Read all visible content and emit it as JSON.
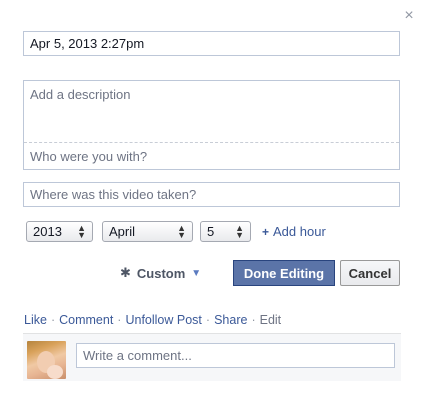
{
  "dialog": {
    "close_glyph": "×"
  },
  "form": {
    "date_value": "Apr 5, 2013 2:27pm",
    "description_placeholder": "Add a description",
    "with_placeholder": "Who were you with?",
    "location_placeholder": "Where was this video taken?"
  },
  "date_selects": {
    "year": "2013",
    "month": "April",
    "day": "5",
    "add_hour_label": "Add hour"
  },
  "controls": {
    "privacy_label": "Custom",
    "done_label": "Done Editing",
    "cancel_label": "Cancel"
  },
  "actions": {
    "like": "Like",
    "comment": "Comment",
    "unfollow": "Unfollow Post",
    "share": "Share",
    "edit": "Edit",
    "separator": "·"
  },
  "comment": {
    "placeholder": "Write a comment..."
  },
  "icons": {
    "close": "close-icon",
    "gear": "gear-icon",
    "caret": "caret-down-icon",
    "plus": "plus-icon",
    "avatar": "user-avatar"
  },
  "colors": {
    "link": "#3b5998",
    "primary_button": "#5b74a8",
    "muted_text": "#6e7484",
    "input_border": "#bdc7d8"
  }
}
